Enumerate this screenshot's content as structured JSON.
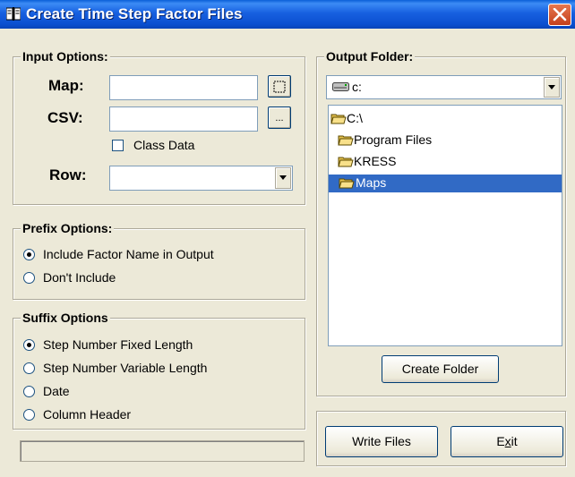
{
  "window": {
    "title": "Create Time Step Factor Files",
    "close_icon": "close-icon"
  },
  "input_options": {
    "legend": "Input Options:",
    "map_label": "Map:",
    "map_value": "",
    "csv_label": "CSV:",
    "csv_value": "",
    "csv_browse_label": "...",
    "class_data_label": "Class Data",
    "class_data_checked": false,
    "row_label": "Row:",
    "row_value": ""
  },
  "prefix_options": {
    "legend": "Prefix Options:",
    "options": [
      "Include Factor Name in Output",
      "Don't Include"
    ],
    "selected": 0
  },
  "suffix_options": {
    "legend": "Suffix Options",
    "options": [
      "Step Number Fixed Length",
      "Step Number Variable Length",
      "Date",
      "Column Header"
    ],
    "selected": 0
  },
  "status_bar": {
    "text": ""
  },
  "output_folder": {
    "legend": "Output Folder:",
    "drive_value": "c:",
    "tree": [
      {
        "label": "C:\\",
        "selected": false
      },
      {
        "label": "Program Files",
        "selected": false
      },
      {
        "label": "KRESS",
        "selected": false
      },
      {
        "label": "Maps",
        "selected": true
      }
    ],
    "create_folder_label": "Create Folder"
  },
  "actions": {
    "write_files_label": "Write Files",
    "exit_label_prefix": "E",
    "exit_label_mnemonic": "x",
    "exit_label_suffix": "it"
  },
  "colors": {
    "selection": "#316ac5",
    "titlebar": "#0a5fd8",
    "face": "#ece9d8"
  }
}
